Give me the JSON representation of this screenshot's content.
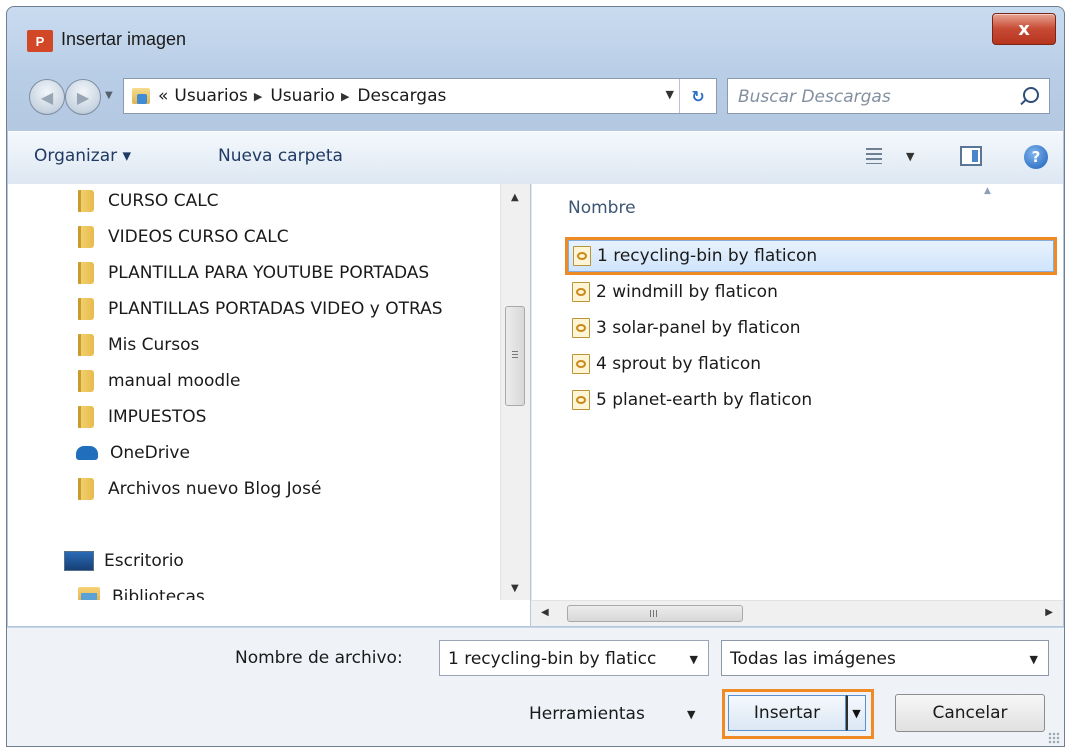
{
  "window": {
    "app_icon_text": "P",
    "title": "Insertar imagen",
    "close_label": "x"
  },
  "address": {
    "overflow": "«",
    "crumbs": [
      "Usuarios",
      "Usuario",
      "Descargas"
    ],
    "search_placeholder": "Buscar Descargas"
  },
  "toolbar": {
    "organize_label": "Organizar ▾",
    "new_folder_label": "Nueva carpeta"
  },
  "nav_tree": {
    "items": [
      {
        "label": "CURSO CALC",
        "icon": "folder-icon"
      },
      {
        "label": "VIDEOS CURSO CALC",
        "icon": "folder-icon"
      },
      {
        "label": "PLANTILLA PARA YOUTUBE PORTADAS",
        "icon": "folder-icon"
      },
      {
        "label": "PLANTILLAS PORTADAS VIDEO y OTRAS",
        "icon": "folder-icon"
      },
      {
        "label": "Mis Cursos",
        "icon": "folder-icon"
      },
      {
        "label": "manual moodle",
        "icon": "folder-icon"
      },
      {
        "label": "IMPUESTOS",
        "icon": "folder-icon"
      },
      {
        "label": "OneDrive",
        "icon": "onedrive-icon"
      },
      {
        "label": "Archivos nuevo Blog José",
        "icon": "folder-icon"
      },
      {
        "label": "Escritorio",
        "icon": "desktop-icon"
      },
      {
        "label": "Bibliotecas",
        "icon": "library-icon"
      }
    ]
  },
  "file_list": {
    "column_header": "Nombre",
    "items": [
      {
        "label": "1 recycling-bin by flaticon",
        "selected": true
      },
      {
        "label": "2 windmill by flaticon",
        "selected": false
      },
      {
        "label": "3 solar-panel by flaticon",
        "selected": false
      },
      {
        "label": "4 sprout by flaticon",
        "selected": false
      },
      {
        "label": "5 planet-earth by flaticon",
        "selected": false
      }
    ]
  },
  "footer": {
    "filename_label": "Nombre de archivo:",
    "filename_value": "1 recycling-bin by flaticc",
    "filetype_value": "Todas las imágenes",
    "tools_label": "Herramientas",
    "insert_label": "Insertar",
    "cancel_label": "Cancelar"
  },
  "colors": {
    "highlight": "#f08a24",
    "selection": "#cfe4fb"
  }
}
